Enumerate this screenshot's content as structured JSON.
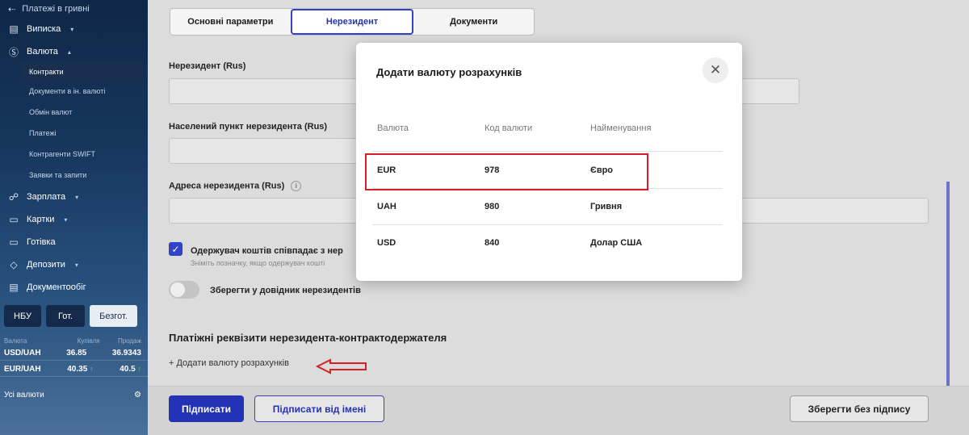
{
  "sidebar": {
    "top_item": "Платежі в гривні",
    "items": [
      {
        "label": "Виписка",
        "icon": "statement-icon",
        "caret": "▾"
      },
      {
        "label": "Валюта",
        "icon": "dollar-circle-icon",
        "caret": "▴"
      }
    ],
    "currency_sub": [
      "Контракти",
      "Документи в ін. валюті",
      "Обмін валют",
      "Платежі",
      "Контрагенти SWIFT",
      "Заявки та запити"
    ],
    "items_after": [
      {
        "label": "Зарплата",
        "icon": "people-icon",
        "caret": "▾"
      },
      {
        "label": "Картки",
        "icon": "card-icon",
        "caret": "▾"
      },
      {
        "label": "Готівка",
        "icon": "wallet-icon",
        "caret": ""
      },
      {
        "label": "Депозити",
        "icon": "deposit-icon",
        "caret": "▾"
      },
      {
        "label": "Документообіг",
        "icon": "document-icon",
        "caret": ""
      }
    ],
    "rate_tabs": [
      "НБУ",
      "Гот.",
      "Безгот."
    ],
    "rates_header": {
      "currency": "Валюта",
      "buy": "Купівля",
      "sell": "Продаж"
    },
    "rates": [
      {
        "pair": "USD/UAH",
        "buy": "36.85",
        "sell": "36.9343",
        "buy_up": false,
        "sell_up": false
      },
      {
        "pair": "EUR/UAH",
        "buy": "40.35",
        "sell": "40.5",
        "buy_up": true,
        "sell_up": true
      }
    ],
    "all_currencies": "Усі валюти"
  },
  "main": {
    "tabs": [
      "Основні параметри",
      "Нерезидент",
      "Документи"
    ],
    "active_tab": "Нерезидент",
    "labels": {
      "nonresident": "Нерезидент (Rus)",
      "city": "Населений пункт нерезидента (Rus)",
      "address": "Адреса нерезидента (Rus)"
    },
    "checkbox_label": "Одержувач коштів співпадає з нер",
    "checkbox_hint": "Зніміть позначку, якщо одержувач кошті",
    "toggle_label": "Зберегти у довідник нерезидентів",
    "section_title": "Платіжні реквізити нерезидента-контрактодержателя",
    "add_currency": "+ Додати валюту розрахунків",
    "buttons": {
      "sign": "Підписати",
      "sign_on_behalf": "Підписати від імені",
      "save_unsigned": "Зберегти без підпису"
    }
  },
  "modal": {
    "title": "Додати валюту розрахунків",
    "columns": [
      "Валюта",
      "Код валюти",
      "Найменування"
    ],
    "rows": [
      {
        "currency": "EUR",
        "code": "978",
        "name": "Євро"
      },
      {
        "currency": "UAH",
        "code": "980",
        "name": "Гривня"
      },
      {
        "currency": "USD",
        "code": "840",
        "name": "Долар США"
      }
    ]
  },
  "colors": {
    "accent": "#2433b6",
    "highlight": "#d81f26",
    "sidebar": "#16375f"
  }
}
